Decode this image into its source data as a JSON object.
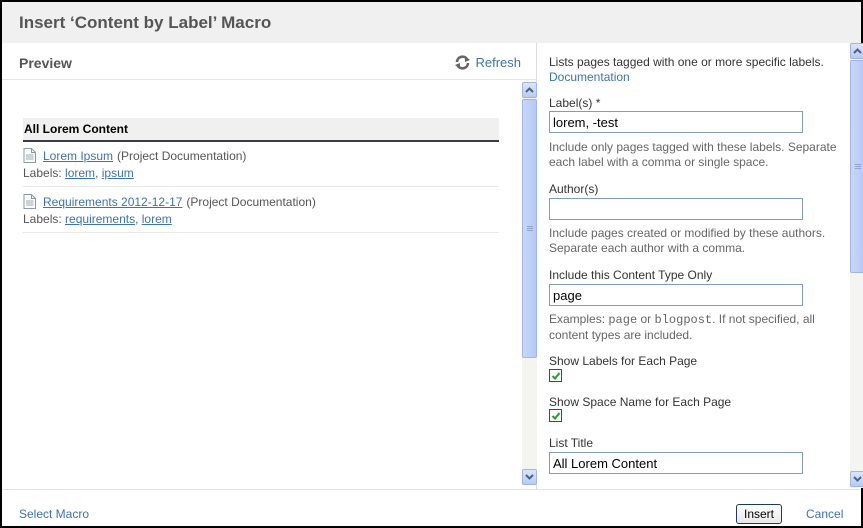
{
  "dialog": {
    "title": "Insert ‘Content by Label’ Macro"
  },
  "preview": {
    "title": "Preview",
    "refresh_label": "Refresh",
    "list_title": "All Lorem Content",
    "items": [
      {
        "title": "Lorem Ipsum",
        "space": "(Project Documentation)",
        "labels_prefix": "Labels:",
        "labels": [
          "lorem",
          "ipsum"
        ]
      },
      {
        "title": "Requirements 2012-12-17",
        "space": "(Project Documentation)",
        "labels_prefix": "Labels:",
        "labels": [
          "requirements",
          "lorem"
        ]
      }
    ]
  },
  "form": {
    "description": "Lists pages tagged with one or more specific labels.",
    "documentation_link": "Documentation",
    "labels_field": {
      "label": "Label(s) *",
      "value": "lorem, -test",
      "help": "Include only pages tagged with these labels. Separate each label with a comma or single space."
    },
    "authors_field": {
      "label": "Author(s)",
      "value": "",
      "help": "Include pages created or modified by these authors. Separate each author with a comma."
    },
    "content_type_field": {
      "label": "Include this Content Type Only",
      "value": "page",
      "help_prefix": "Examples: ",
      "help_code1": "page",
      "help_or": " or ",
      "help_code2": "blogpost",
      "help_suffix": ". If not specified, all content types are included."
    },
    "show_labels": {
      "label": "Show Labels for Each Page",
      "checked": true
    },
    "show_space": {
      "label": "Show Space Name for Each Page",
      "checked": true
    },
    "list_title_field": {
      "label": "List Title",
      "value": "All Lorem Content"
    }
  },
  "footer": {
    "select_macro": "Select Macro",
    "insert": "Insert",
    "cancel": "Cancel"
  }
}
